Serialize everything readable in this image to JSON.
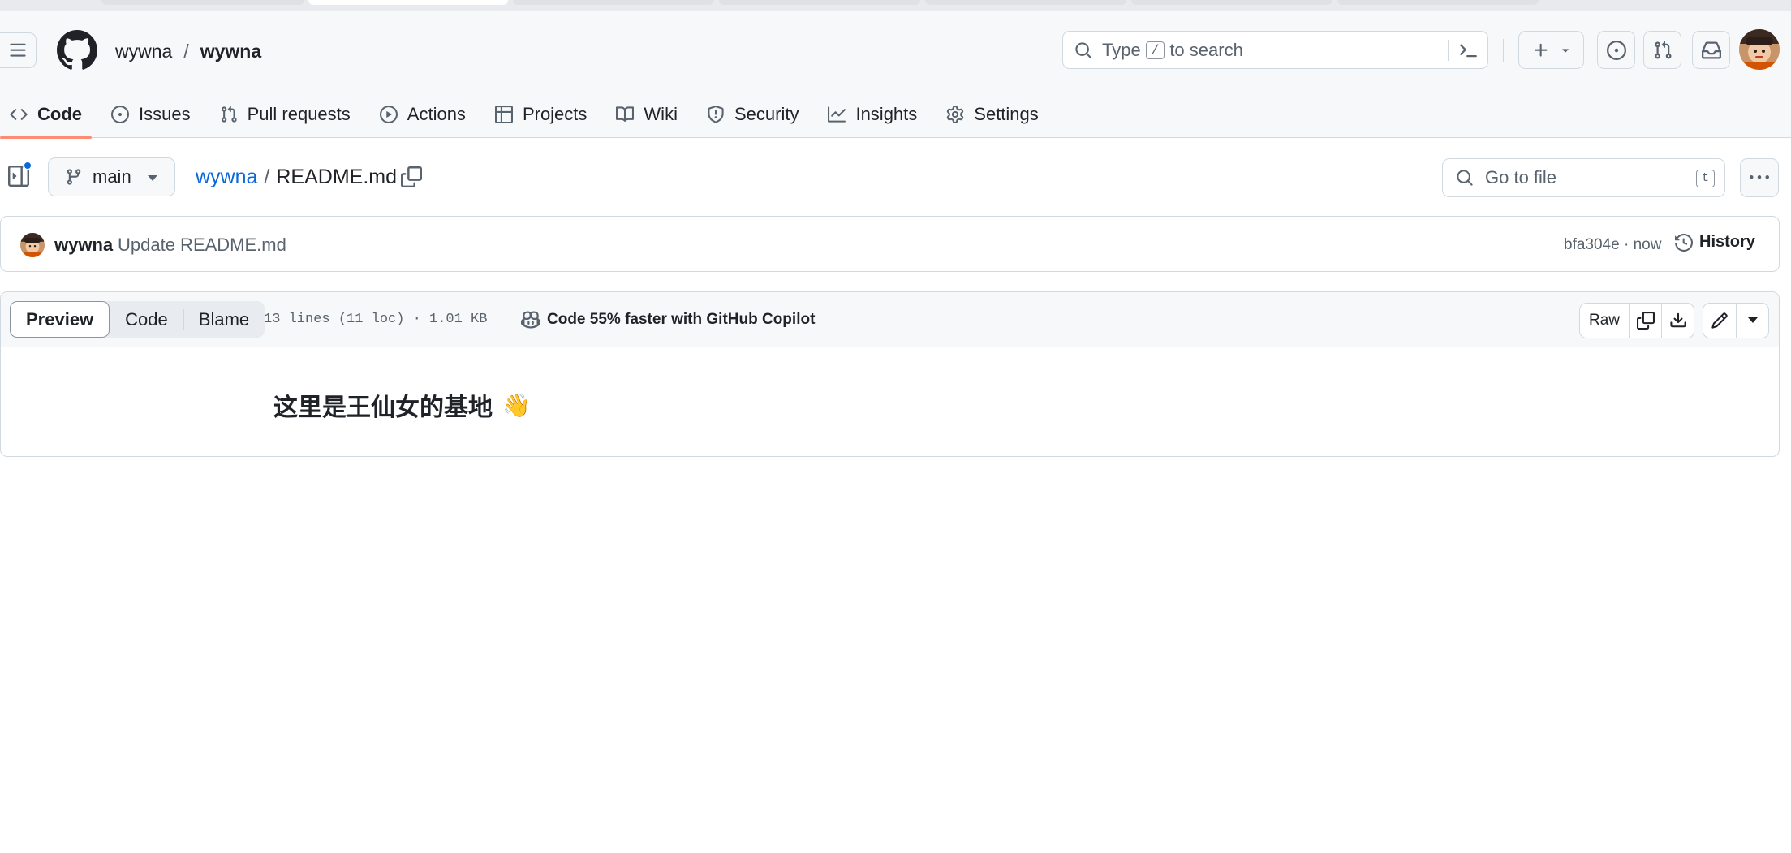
{
  "header": {
    "context": {
      "owner": "wywna",
      "separator": "/",
      "repo": "wywna"
    },
    "search": {
      "placeholder_prefix": "Type",
      "placeholder_key": "/",
      "placeholder_suffix": "to search"
    }
  },
  "nav": {
    "tabs": [
      {
        "label": "Code",
        "icon": "code-icon",
        "selected": true
      },
      {
        "label": "Issues",
        "icon": "issue-opened-icon"
      },
      {
        "label": "Pull requests",
        "icon": "git-pull-request-icon"
      },
      {
        "label": "Actions",
        "icon": "play-icon"
      },
      {
        "label": "Projects",
        "icon": "table-icon"
      },
      {
        "label": "Wiki",
        "icon": "book-icon"
      },
      {
        "label": "Security",
        "icon": "shield-icon"
      },
      {
        "label": "Insights",
        "icon": "graph-icon"
      },
      {
        "label": "Settings",
        "icon": "gear-icon"
      }
    ]
  },
  "file_header": {
    "branch": "main",
    "breadcrumb_owner": "wywna",
    "breadcrumb_sep": "/",
    "file_name": "README.md",
    "goto_placeholder": "Go to file",
    "goto_key": "t"
  },
  "commit": {
    "author": "wywna",
    "message": "Update README.md",
    "sha_time": "bfa304e · now",
    "history_label": "History"
  },
  "file": {
    "view_modes": [
      "Preview",
      "Code",
      "Blame"
    ],
    "active_mode": "Preview",
    "info": "13 lines (11 loc) · 1.01 KB",
    "copilot": "Code 55% faster with GitHub Copilot",
    "raw_label": "Raw"
  },
  "content": {
    "heading": "这里是王仙女的基地",
    "emoji": "👋"
  },
  "colors": {
    "accent_link": "#0969da",
    "selected_underline": "#fd8c73",
    "border": "#d1d9e0",
    "header_bg": "#f6f8fa"
  }
}
